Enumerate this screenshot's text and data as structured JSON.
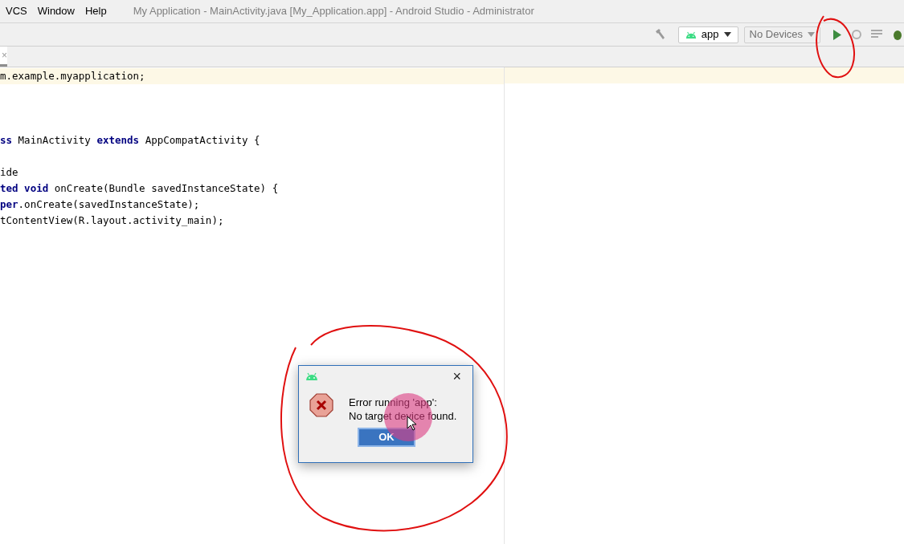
{
  "menu": [
    {
      "label": "VCS"
    },
    {
      "label": "Window"
    },
    {
      "label": "Help"
    }
  ],
  "window": {
    "title": "My Application - MainActivity.java [My_Application.app] - Android Studio - Administrator"
  },
  "toolbar": {
    "config": "app",
    "device": "No Devices"
  },
  "tab": {
    "close": "×"
  },
  "code_lines": [
    {
      "segments": [
        {
          "text": "m.example.myapplication;",
          "kind": "plain"
        }
      ],
      "highlighted": true
    },
    {
      "highlighted": false
    },
    {
      "highlighted": false
    },
    {
      "highlighted": false
    },
    {
      "segments": [
        {
          "text": "ss ",
          "kind": "keyword"
        },
        {
          "text": "MainActivity ",
          "kind": "plain"
        },
        {
          "text": "extends ",
          "kind": "keyword"
        },
        {
          "text": "AppCompatActivity {",
          "kind": "plain"
        }
      ],
      "highlighted": false
    },
    {
      "highlighted": false
    },
    {
      "segments": [
        {
          "text": "ide",
          "kind": "plain"
        }
      ],
      "highlighted": false
    },
    {
      "segments": [
        {
          "text": "ted void ",
          "kind": "keyword"
        },
        {
          "text": "onCreate(Bundle savedInstanceState) {",
          "kind": "plain"
        }
      ],
      "highlighted": false
    },
    {
      "segments": [
        {
          "text": "per",
          "kind": "keyword"
        },
        {
          "text": ".onCreate(savedInstanceState);",
          "kind": "plain"
        }
      ],
      "highlighted": false
    },
    {
      "segments": [
        {
          "text": "tContentView(R.layout.activity_main);",
          "kind": "plain"
        }
      ],
      "highlighted": false
    }
  ],
  "dialog": {
    "close": "×",
    "message_lines": [
      "Error running 'app':",
      "No target device found."
    ],
    "button": "OK"
  }
}
